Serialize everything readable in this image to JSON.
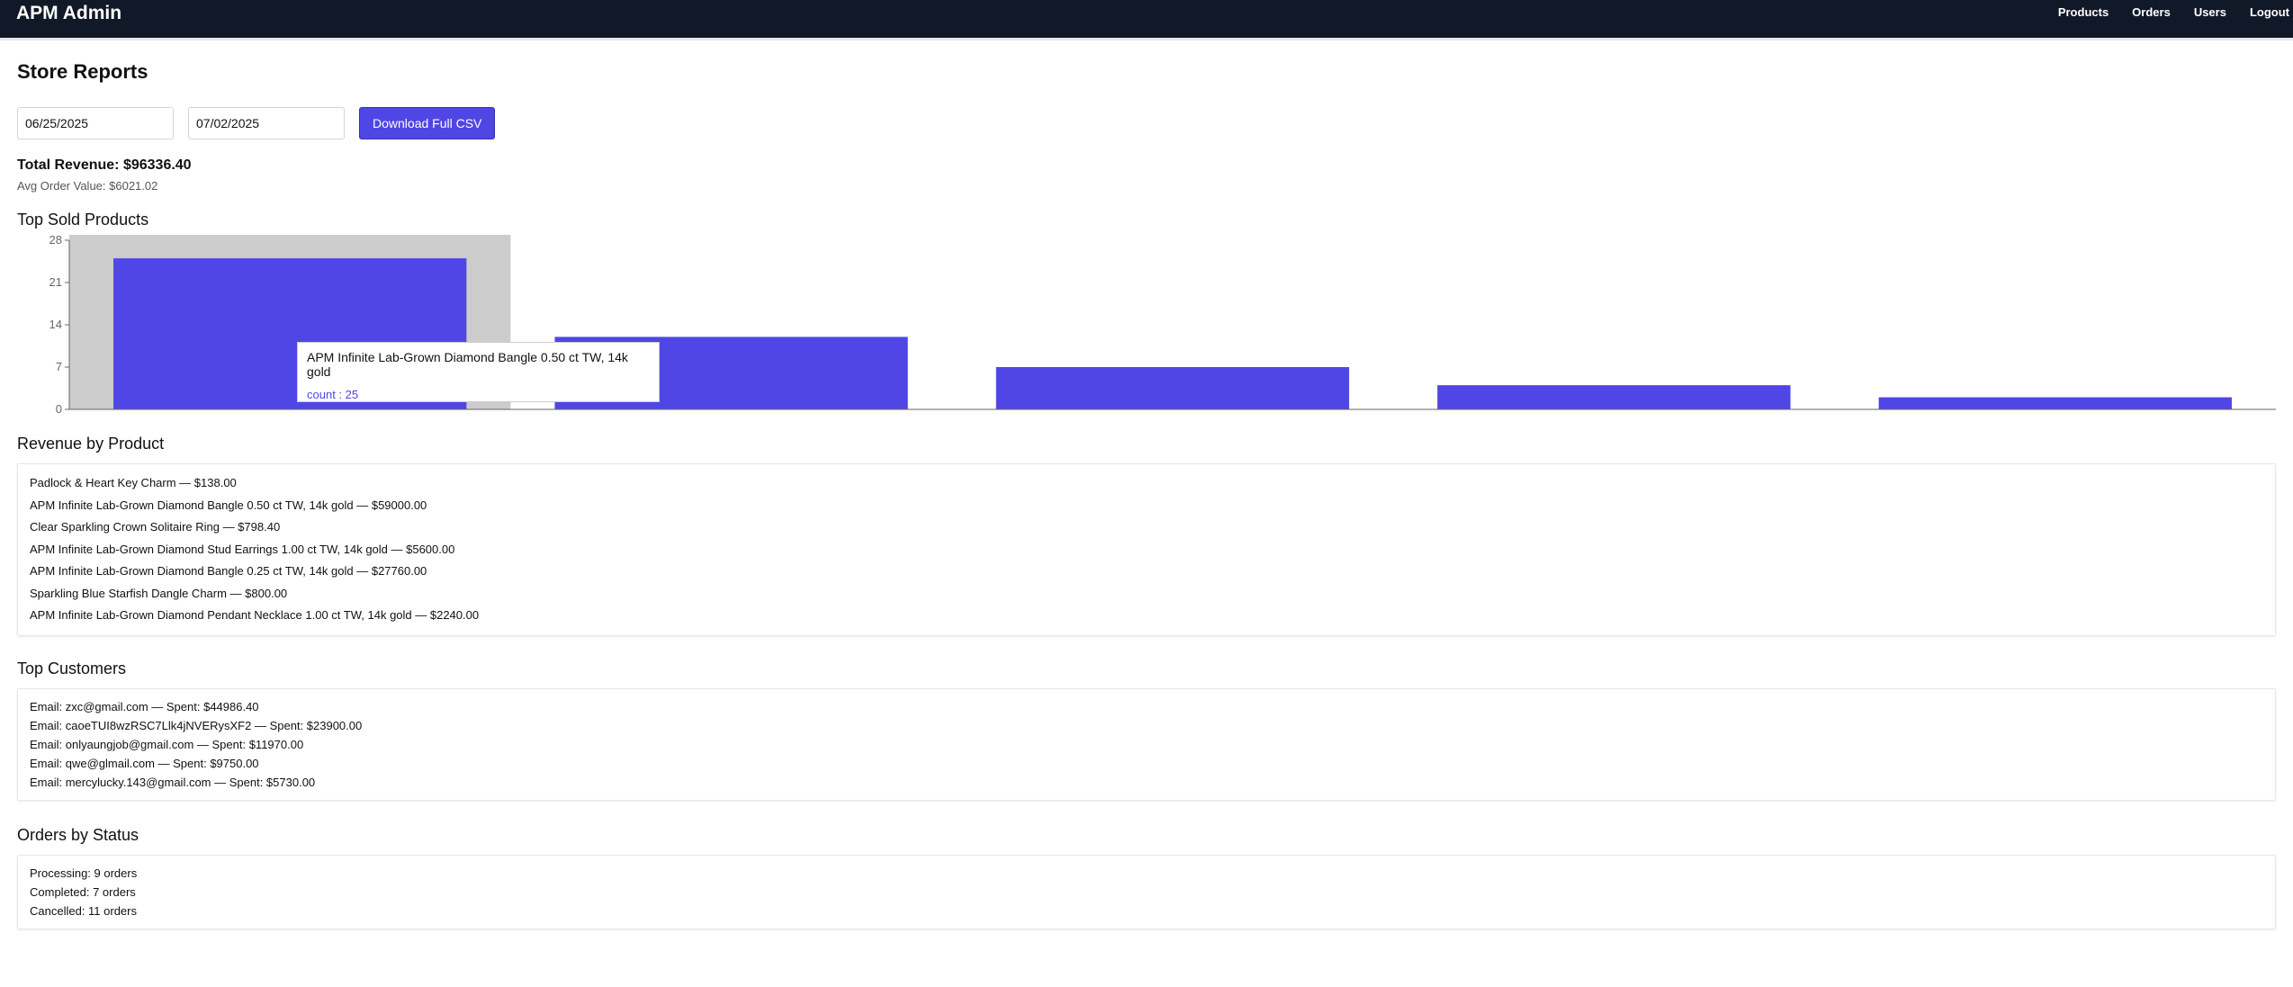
{
  "header": {
    "brand": "APM Admin",
    "nav": [
      "Products",
      "Orders",
      "Users",
      "Logout"
    ]
  },
  "page": {
    "title": "Store Reports",
    "start_date": "06/25/2025",
    "end_date": "07/02/2025",
    "download_label": "Download Full CSV",
    "total_revenue": "Total Revenue: $96336.40",
    "avg_order_value": "Avg Order Value: $6021.02"
  },
  "top_sold": {
    "title": "Top Sold Products",
    "tooltip": {
      "name": "APM Infinite Lab-Grown Diamond Bangle 0.50 ct TW, 14k gold",
      "count": "count : 25"
    }
  },
  "chart_data": {
    "type": "bar",
    "categories": [
      "APM Infinite Lab-Grown Diamond Bangle 0.50 ct TW, 14k gold",
      "",
      "",
      "",
      ""
    ],
    "values": [
      25,
      12,
      7,
      4,
      2
    ],
    "yticks": [
      "0",
      "7",
      "14",
      "21",
      "28"
    ],
    "ylim": [
      0,
      28
    ],
    "bar_color": "#4f46e5",
    "highlight_index": 0,
    "highlight_color": "#cccccc"
  },
  "revenue_by_product": {
    "title": "Revenue by Product",
    "items": [
      "Padlock & Heart Key Charm — $138.00",
      "APM Infinite Lab-Grown Diamond Bangle 0.50 ct TW, 14k gold — $59000.00",
      "Clear Sparkling Crown Solitaire Ring — $798.40",
      "APM Infinite Lab-Grown Diamond Stud Earrings 1.00 ct TW, 14k gold — $5600.00",
      "APM Infinite Lab-Grown Diamond Bangle 0.25 ct TW, 14k gold — $27760.00",
      "Sparkling Blue Starfish Dangle Charm — $800.00",
      "APM Infinite Lab-Grown Diamond Pendant Necklace 1.00 ct TW, 14k gold — $2240.00"
    ]
  },
  "top_customers": {
    "title": "Top Customers",
    "items": [
      "Email: zxc@gmail.com — Spent: $44986.40",
      "Email: caoeTUI8wzRSC7Llk4jNVERysXF2 — Spent: $23900.00",
      "Email: onlyaungjob@gmail.com — Spent: $11970.00",
      "Email: qwe@glmail.com — Spent: $9750.00",
      "Email: mercylucky.143@gmail.com — Spent: $5730.00"
    ]
  },
  "orders_by_status": {
    "title": "Orders by Status",
    "items": [
      "Processing: 9 orders",
      "Completed: 7 orders",
      "Cancelled: 11 orders"
    ]
  }
}
